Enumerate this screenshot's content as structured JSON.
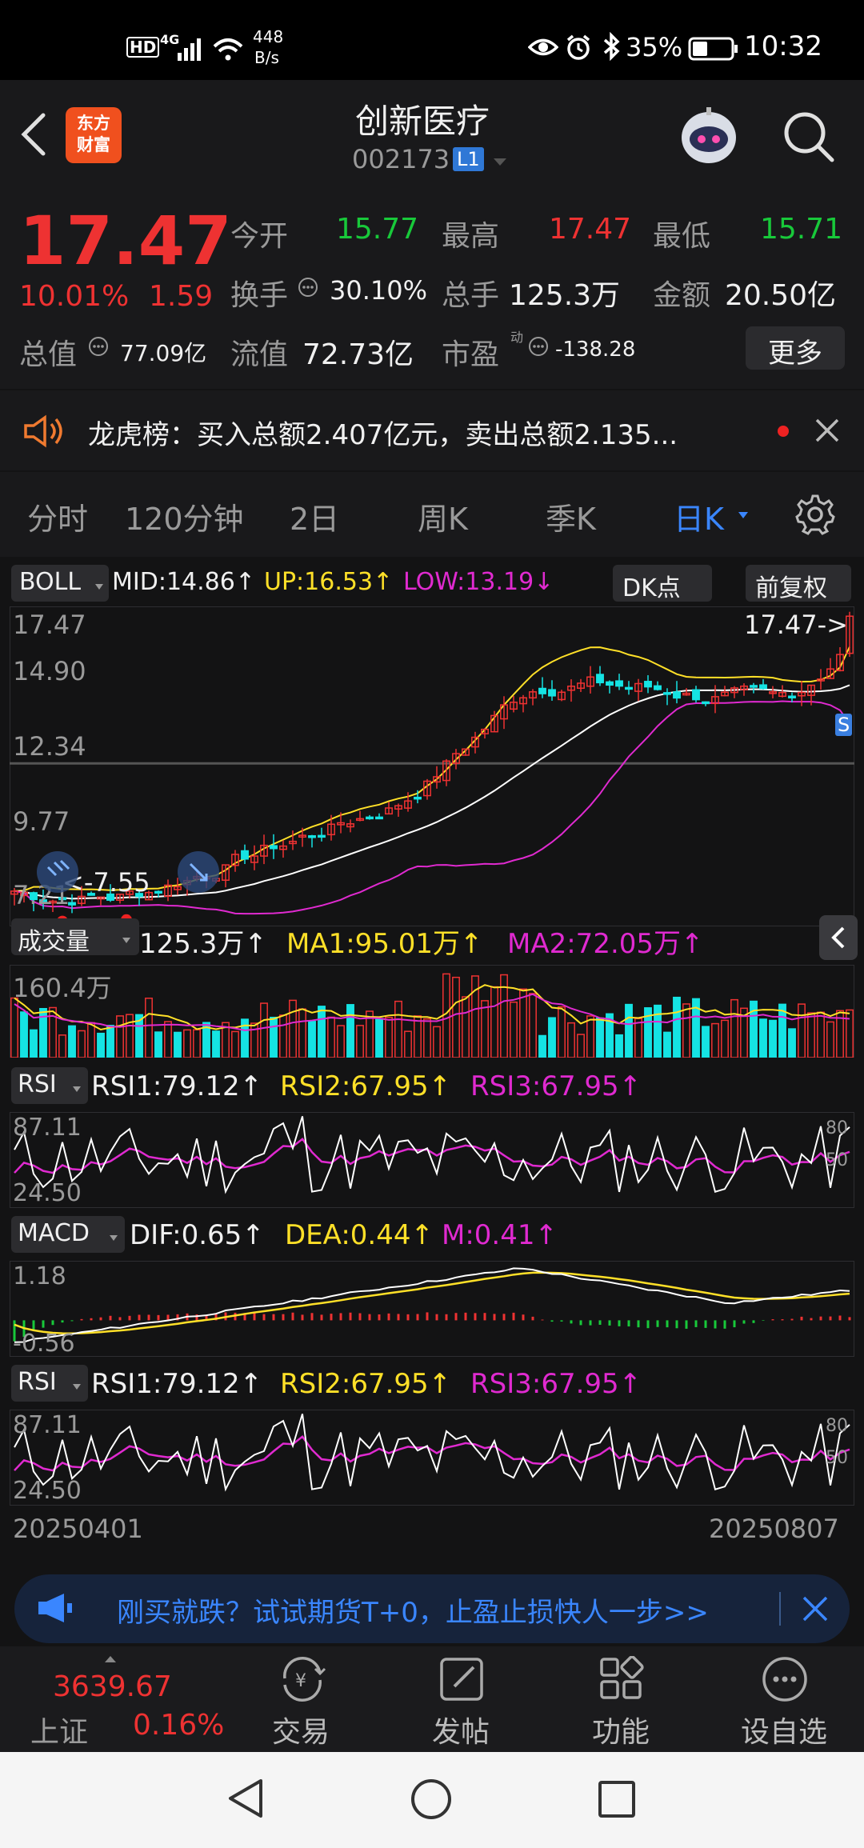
{
  "status_bar": {
    "hd": "HD",
    "network": "4G",
    "speed_value": "448",
    "speed_unit": "B/s",
    "battery": "35%",
    "time": "10:32"
  },
  "header": {
    "title": "创新医疗",
    "code": "002173",
    "level_badge": "L1",
    "logo_line1": "东方",
    "logo_line2": "财富"
  },
  "quote": {
    "price": "17.47",
    "change_pct": "10.01%",
    "change_amt": "1.59",
    "open_label": "今开",
    "open": "15.77",
    "high_label": "最高",
    "high": "17.47",
    "low_label": "最低",
    "low": "15.71",
    "turnover_label": "换手",
    "turnover": "30.10%",
    "volume_label": "总手",
    "volume": "125.3万",
    "amount_label": "金额",
    "amount": "20.50亿",
    "mktcap_label": "总值",
    "mktcap": "77.09亿",
    "float_label": "流值",
    "float_cap": "72.73亿",
    "pe_label": "市盈",
    "pe_sup": "动",
    "pe": "-138.28",
    "more_label": "更多"
  },
  "lhb_notice": "龙虎榜：买入总额2.407亿元，卖出总额2.135...",
  "tabs": [
    "分时",
    "120分钟",
    "2日",
    "周K",
    "季K",
    "日K"
  ],
  "active_tab": "日K",
  "main_chart": {
    "indicator": "BOLL",
    "mid": "MID:14.86↑",
    "up": "UP:16.53↑",
    "low": "LOW:13.19↓",
    "dk_label": "DK点",
    "adjust_label": "前复权",
    "price_ticks": [
      "17.47",
      "14.90",
      "12.34",
      "9.77",
      "7.21"
    ],
    "max_marker": "17.47->",
    "min_marker": "<-7.55",
    "s_badge": "S"
  },
  "volume_panel": {
    "label": "成交量",
    "value": "125.3万↑",
    "ma1": "MA1:95.01万↑",
    "ma2": "MA2:72.05万↑",
    "tick": "160.4万"
  },
  "rsi_panel": {
    "label": "RSI",
    "rsi1": "RSI1:79.12↑",
    "rsi2": "RSI2:67.95↑",
    "rsi3": "RSI3:67.95↑",
    "tick_high": "87.11",
    "tick_low": "24.50",
    "right_a": "80",
    "right_b": "50"
  },
  "macd_panel": {
    "label": "MACD",
    "dif": "DIF:0.65↑",
    "dea": "DEA:0.44↑",
    "m": "M:0.41↑",
    "tick_high": "1.18",
    "tick_low": "-0.56"
  },
  "date_start": "20250401",
  "date_end": "20250807",
  "promo_banner": "刚买就跌？试试期货T+0，止盈止损快人一步>>",
  "bottom_bar": {
    "index_value": "3639.67",
    "index_name": "上证",
    "index_change": "0.16%",
    "items": [
      "交易",
      "发帖",
      "功能",
      "设自选"
    ]
  },
  "colors": {
    "up": "#ee3232",
    "down": "#18c93a",
    "volume_down": "#15e3e3",
    "mid_line": "#ffffff",
    "up_band": "#ffe028",
    "low_band": "#e02ad0",
    "active_tab": "#3a86ff"
  }
}
